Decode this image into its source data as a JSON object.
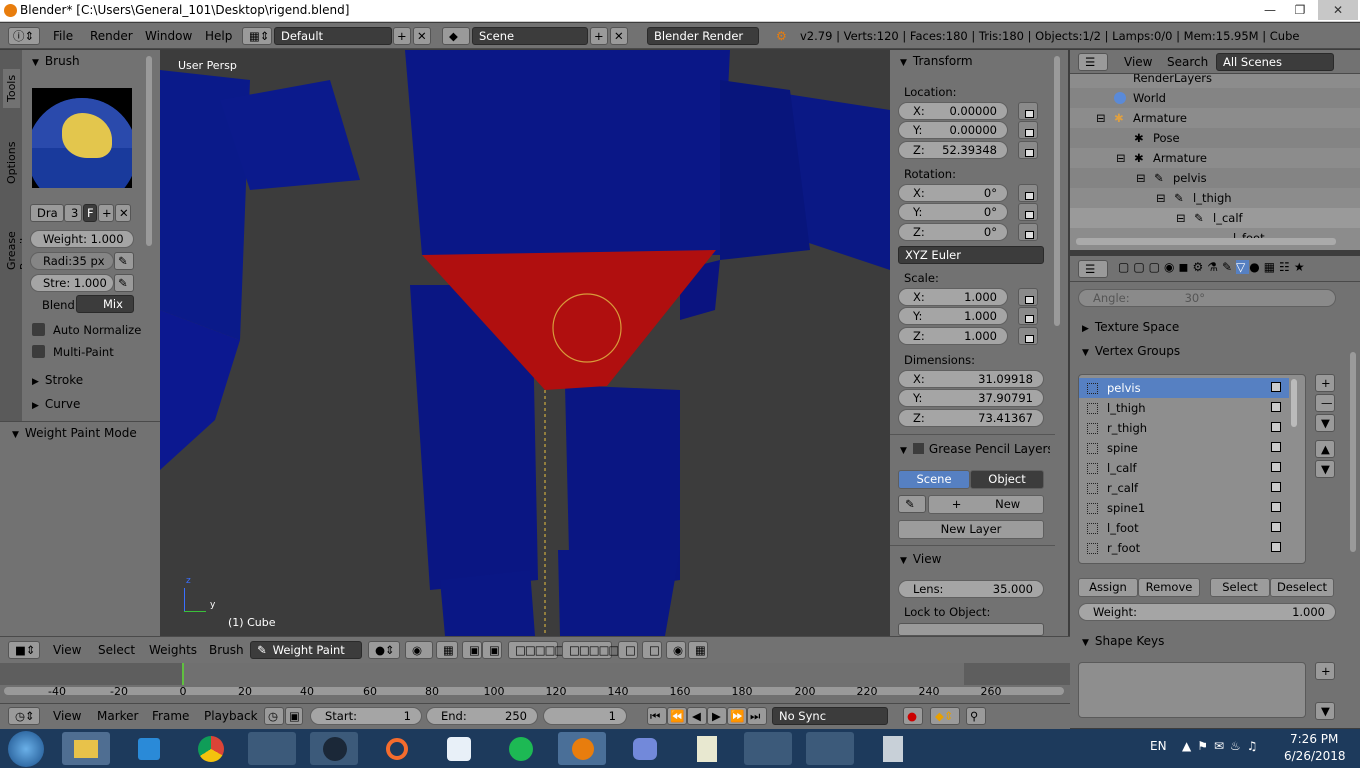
{
  "window": {
    "title": "Blender* [C:\\Users\\General_101\\Desktop\\rigend.blend]"
  },
  "info": {
    "menus": [
      "File",
      "Render",
      "Window",
      "Help"
    ],
    "layout": "Default",
    "scene": "Scene",
    "engine": "Blender Render",
    "stats": "v2.79 | Verts:120 | Faces:180 | Tris:180 | Objects:1/2 | Lamps:0/0 | Mem:15.95M | Cube"
  },
  "toolshelf": {
    "tabs": [
      "Tools",
      "Options",
      "Grease Pencil"
    ],
    "brush_header": "Brush",
    "brush_name": "Dra",
    "brush_users": "3",
    "brush_fake": "F",
    "weight": "Weight:  1.000",
    "radius": "Radi:35 px",
    "strength": "Stre: 1.000",
    "blend_label": "Blend:",
    "blend_value": "Mix",
    "auto_normalize": "Auto Normalize",
    "multi_paint": "Multi-Paint",
    "stroke": "Stroke",
    "curve": "Curve",
    "mode_panel": "Weight Paint Mode"
  },
  "viewport": {
    "persp": "User Persp",
    "object": "(1) Cube",
    "axis_x": "y",
    "axis_z": "z"
  },
  "transform": {
    "header": "Transform",
    "location_label": "Location:",
    "loc": [
      {
        "axis": "X:",
        "value": "0.00000"
      },
      {
        "axis": "Y:",
        "value": "0.00000"
      },
      {
        "axis": "Z:",
        "value": "52.39348"
      }
    ],
    "rotation_label": "Rotation:",
    "rot": [
      {
        "axis": "X:",
        "value": "0°"
      },
      {
        "axis": "Y:",
        "value": "0°"
      },
      {
        "axis": "Z:",
        "value": "0°"
      }
    ],
    "rot_mode": "XYZ Euler",
    "scale_label": "Scale:",
    "scale": [
      {
        "axis": "X:",
        "value": "1.000"
      },
      {
        "axis": "Y:",
        "value": "1.000"
      },
      {
        "axis": "Z:",
        "value": "1.000"
      }
    ],
    "dimensions_label": "Dimensions:",
    "dim": [
      {
        "axis": "X:",
        "value": "31.09918"
      },
      {
        "axis": "Y:",
        "value": "37.90791"
      },
      {
        "axis": "Z:",
        "value": "73.41367"
      }
    ]
  },
  "gpencil": {
    "header": "Grease Pencil Layers",
    "scene_tab": "Scene",
    "object_tab": "Object",
    "new": "New",
    "new_layer": "New Layer"
  },
  "view_panel": {
    "header": "View",
    "lens_label": "Lens:",
    "lens_value": "35.000",
    "lock_label": "Lock to Object:"
  },
  "outliner": {
    "menus": [
      "View",
      "Search"
    ],
    "filter": "All Scenes",
    "items": [
      {
        "label": "RenderLayers",
        "indent": 3
      },
      {
        "label": "World",
        "indent": 2
      },
      {
        "label": "Armature",
        "indent": 1
      },
      {
        "label": "Pose",
        "indent": 3
      },
      {
        "label": "Armature",
        "indent": 3
      },
      {
        "label": "pelvis",
        "indent": 4
      },
      {
        "label": "l_thigh",
        "indent": 5
      },
      {
        "label": "l_calf",
        "indent": 6
      },
      {
        "label": "l_foot",
        "indent": 7
      }
    ]
  },
  "properties": {
    "angle_label": "Angle:",
    "angle_value": "30°",
    "texture_space": "Texture Space",
    "vertex_groups": "Vertex Groups",
    "groups": [
      "pelvis",
      "l_thigh",
      "r_thigh",
      "spine",
      "l_calf",
      "r_calf",
      "spine1",
      "l_foot",
      "r_foot"
    ],
    "assign": "Assign",
    "remove": "Remove",
    "select": "Select",
    "deselect": "Deselect",
    "weight_label": "Weight:",
    "weight_value": "1.000",
    "shape_keys": "Shape Keys"
  },
  "view3d_header": {
    "menus": [
      "View",
      "Select",
      "Weights",
      "Brush"
    ],
    "mode": "Weight Paint"
  },
  "timeline": {
    "ticks": [
      "-40",
      "-20",
      "0",
      "20",
      "40",
      "60",
      "80",
      "100",
      "120",
      "140",
      "160",
      "180",
      "200",
      "220",
      "240",
      "260"
    ],
    "menus": [
      "View",
      "Marker",
      "Frame",
      "Playback"
    ],
    "start": "Start:",
    "start_val": "1",
    "end": "End:",
    "end_val": "250",
    "current": "1",
    "sync": "No Sync"
  },
  "taskbar": {
    "lang": "EN",
    "time": "7:26 PM",
    "date": "6/26/2018"
  }
}
